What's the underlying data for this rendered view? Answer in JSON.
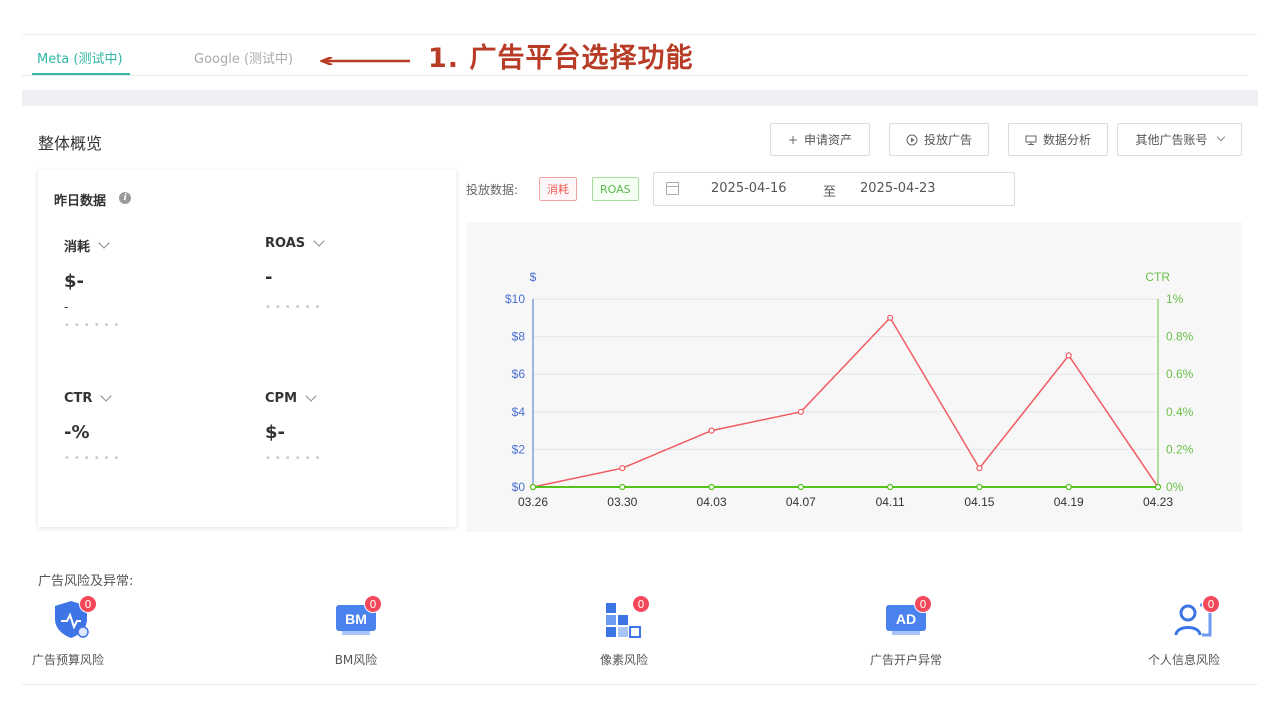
{
  "tabs": [
    {
      "label": "Meta (测试中)",
      "active": true
    },
    {
      "label": "Google (测试中)",
      "active": false
    }
  ],
  "annotation": {
    "text": "1. 广告平台选择功能",
    "color": "#b83b25"
  },
  "overview": {
    "title": "整体概览"
  },
  "toolbar": {
    "apply_label": "申请资产",
    "launch_label": "投放广告",
    "analysis_label": "数据分析",
    "other_accounts_label": "其他广告账号"
  },
  "yesterday": {
    "title": "昨日数据",
    "info_icon": "i",
    "metrics": {
      "spend": {
        "label": "消耗",
        "value": "$-",
        "sub": "-",
        "dots": "••••••"
      },
      "roas": {
        "label": "ROAS",
        "value": "-",
        "sub": "",
        "dots": "••••••"
      },
      "ctr": {
        "label": "CTR",
        "value": "-%",
        "sub": "",
        "dots": "••••••"
      },
      "cpm": {
        "label": "CPM",
        "value": "$-",
        "sub": "",
        "dots": "••••••"
      }
    }
  },
  "filters": {
    "label": "投放数据:",
    "tag_spend": "消耗",
    "tag_roas": "ROAS",
    "date_start": "2025-04-16",
    "date_sep": "至",
    "date_end": "2025-04-23"
  },
  "colors": {
    "accent": "#2fb7a6",
    "spend_line": "#f15b61",
    "ctr_line": "#52c41a",
    "left_axis": "#4a6fd1",
    "right_axis": "#6cc04a"
  },
  "chart_data": {
    "type": "line",
    "x": [
      "03.26",
      "03.30",
      "04.03",
      "04.07",
      "04.11",
      "04.15",
      "04.19",
      "04.23"
    ],
    "left_axis": {
      "label": "$",
      "ticks": [
        "$0",
        "$2",
        "$4",
        "$6",
        "$8",
        "$10"
      ],
      "range": [
        0,
        10
      ]
    },
    "right_axis": {
      "label": "CTR",
      "ticks": [
        "0%",
        "0.2%",
        "0.4%",
        "0.6%",
        "0.8%",
        "1%"
      ],
      "range": [
        0,
        1
      ]
    },
    "series": [
      {
        "name": "消耗",
        "axis": "left",
        "values": [
          0,
          1,
          3,
          4,
          9,
          1,
          7,
          0
        ]
      },
      {
        "name": "CTR",
        "axis": "right",
        "values": [
          0,
          0,
          0,
          0,
          0,
          0,
          0,
          0
        ]
      }
    ],
    "grid": true
  },
  "risks": {
    "title": "广告风险及异常:",
    "items": [
      {
        "label": "广告预算风险",
        "count": "0",
        "icon": "shield-pulse-icon"
      },
      {
        "label": "BM风险",
        "count": "0",
        "icon": "bm-icon",
        "icon_text": "BM"
      },
      {
        "label": "像素风险",
        "count": "0",
        "icon": "pixel-blocks-icon"
      },
      {
        "label": "广告开户异常",
        "count": "0",
        "icon": "ad-icon",
        "icon_text": "AD"
      },
      {
        "label": "个人信息风险",
        "count": "0",
        "icon": "person-card-icon"
      }
    ]
  }
}
